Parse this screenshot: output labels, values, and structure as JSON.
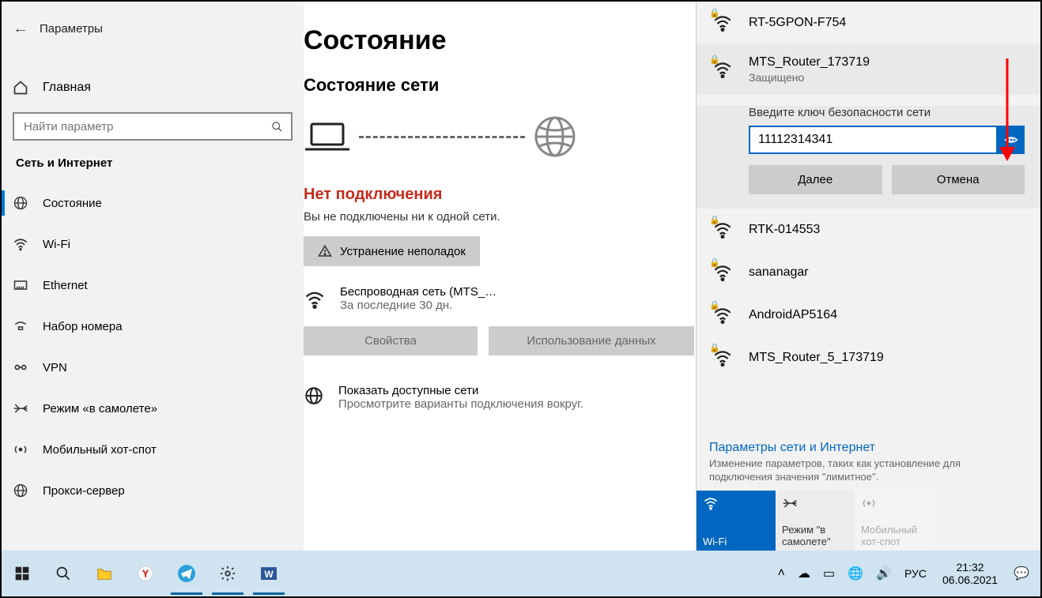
{
  "app_title": "Параметры",
  "search_placeholder": "Найти параметр",
  "home_label": "Главная",
  "section_title": "Сеть и Интернет",
  "nav": {
    "status": "Состояние",
    "wifi": "Wi-Fi",
    "ethernet": "Ethernet",
    "dialup": "Набор номера",
    "vpn": "VPN",
    "airplane": "Режим «в самолете»",
    "hotspot": "Мобильный хот-спот",
    "proxy": "Прокси-сервер"
  },
  "page": {
    "title": "Состояние",
    "subhead": "Состояние сети",
    "err_h": "Нет подключения",
    "err_sub": "Вы не подключены ни к одной сети.",
    "trouble": "Устранение неполадок",
    "wifi_name": "Беспроводная сеть (MTS_…",
    "wifi_sub": "За последние 30 дн.",
    "btn_props": "Свойства",
    "btn_usage": "Использование данных",
    "show_t1": "Показать доступные сети",
    "show_t2": "Просмотрите варианты подключения вокруг."
  },
  "popup": {
    "networks": [
      {
        "name": "RT-5GPON-F754",
        "secured": true
      },
      {
        "name": "MTS_Router_173719",
        "secured": true,
        "status": "Защищено",
        "selected": true
      },
      {
        "name": "RTK-014553",
        "secured": true
      },
      {
        "name": "sananagar",
        "secured": true
      },
      {
        "name": "AndroidAP5164",
        "secured": true
      },
      {
        "name": "MTS_Router_5_173719",
        "secured": true
      }
    ],
    "prompt": "Введите ключ безопасности сети",
    "password_value": "11112314341",
    "btn_next": "Далее",
    "btn_cancel": "Отмена",
    "footer_title": "Параметры сети и Интернет",
    "footer_sub": "Изменение параметров, таких как установление для подключения значения \"лимитное\".",
    "tile_wifi": "Wi-Fi",
    "tile_airplane": "Режим \"в самолете\"",
    "tile_hotspot": "Мобильный хот-спот"
  },
  "taskbar": {
    "lang": "РУС",
    "time": "21:32",
    "date": "06.06.2021"
  }
}
